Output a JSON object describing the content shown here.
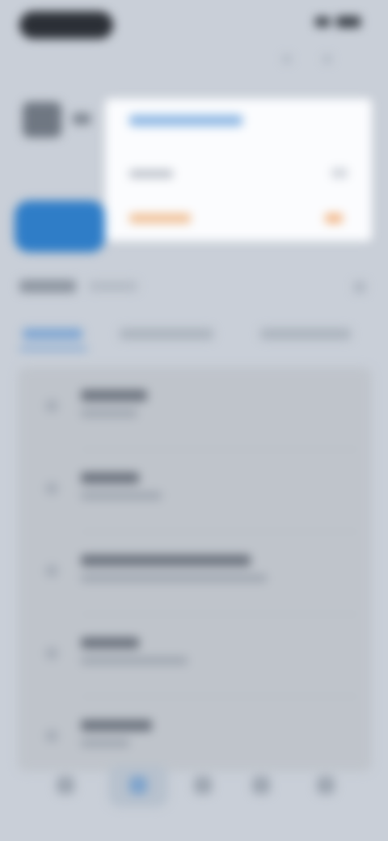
{
  "screen": {
    "title": "",
    "blurred": true
  },
  "status_bar": {
    "time": "",
    "signal_icon": "signal-icon",
    "battery_icon": "battery-icon"
  },
  "profile": {
    "avatar_icon": "avatar-icon",
    "chevron_icon": "chevron-right-icon",
    "primary_button_label": ""
  },
  "card": {
    "title": "",
    "subtitle": "",
    "footer_left": "",
    "footer_right": ""
  },
  "section": {
    "title": "",
    "subtitle": ""
  },
  "tabs": [
    {
      "label": "",
      "active": true
    },
    {
      "label": "",
      "active": false
    },
    {
      "label": "",
      "active": false
    }
  ],
  "list": [
    {
      "title": "",
      "subtitle": ""
    },
    {
      "title": "",
      "subtitle": ""
    },
    {
      "title": "",
      "subtitle": ""
    },
    {
      "title": "",
      "subtitle": ""
    },
    {
      "title": "",
      "subtitle": ""
    }
  ],
  "bottom_nav": [
    {
      "label": "",
      "icon": "home-icon",
      "active": false
    },
    {
      "label": "",
      "icon": "compass-icon",
      "active": true
    },
    {
      "label": "",
      "icon": "list-icon",
      "active": false
    },
    {
      "label": "",
      "icon": "message-icon",
      "active": false
    },
    {
      "label": "",
      "icon": "profile-icon",
      "active": false
    }
  ],
  "colors": {
    "background": "#c9cfd8",
    "accent": "#2f7dc7",
    "card": "#fbfcfe",
    "warning": "#f1b585"
  }
}
